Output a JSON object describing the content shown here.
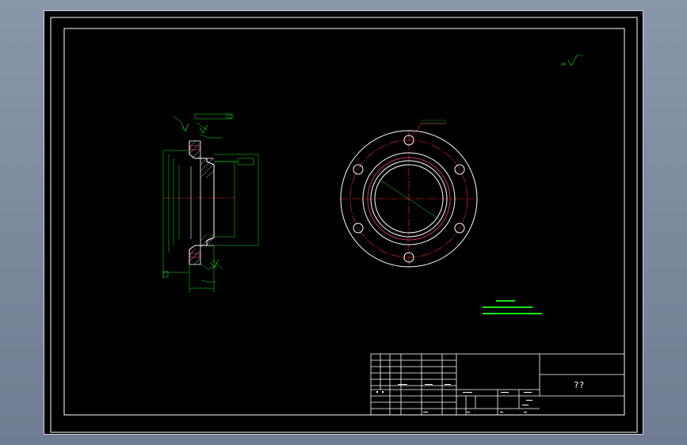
{
  "title_block": {
    "name_cell": "??"
  },
  "colors": {
    "background": "#000000",
    "outline": "#ffffff",
    "dimension": "#19e619",
    "centerline": "#ff2a2a",
    "hidden": "#ff3a8a",
    "app_chrome": "#7d8aa0"
  }
}
